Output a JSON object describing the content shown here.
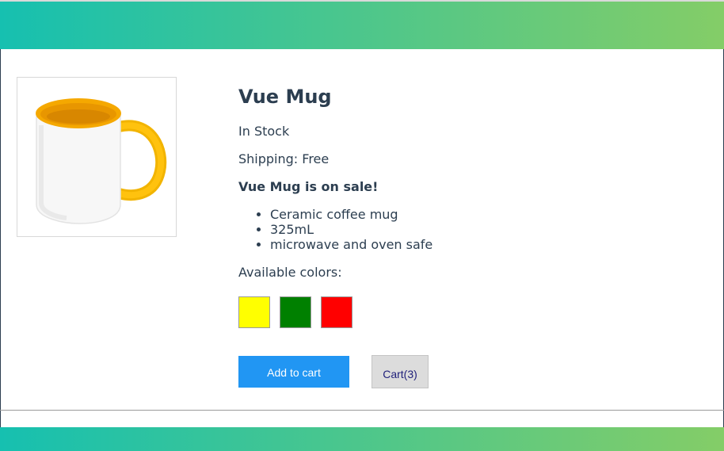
{
  "product": {
    "name": "Vue Mug",
    "stock_status": "In Stock",
    "shipping": "Shipping: Free",
    "sale_message": "Vue Mug is on sale!",
    "details": [
      "Ceramic coffee mug",
      "325mL",
      "microwave and oven safe"
    ],
    "colors_label": "Available colors:",
    "colors": [
      {
        "name": "yellow",
        "hex": "#ffff00"
      },
      {
        "name": "green",
        "hex": "#008000"
      },
      {
        "name": "red",
        "hex": "#ff0000"
      }
    ],
    "image_icon": "mug-icon"
  },
  "actions": {
    "add_to_cart_label": "Add to cart",
    "add_to_cart_color": "#2196f3",
    "cart_label": "Cart(3)"
  },
  "theme": {
    "gradient_start": "#16c0b0",
    "gradient_end": "#84cd67",
    "text_color": "#2c3e50"
  }
}
